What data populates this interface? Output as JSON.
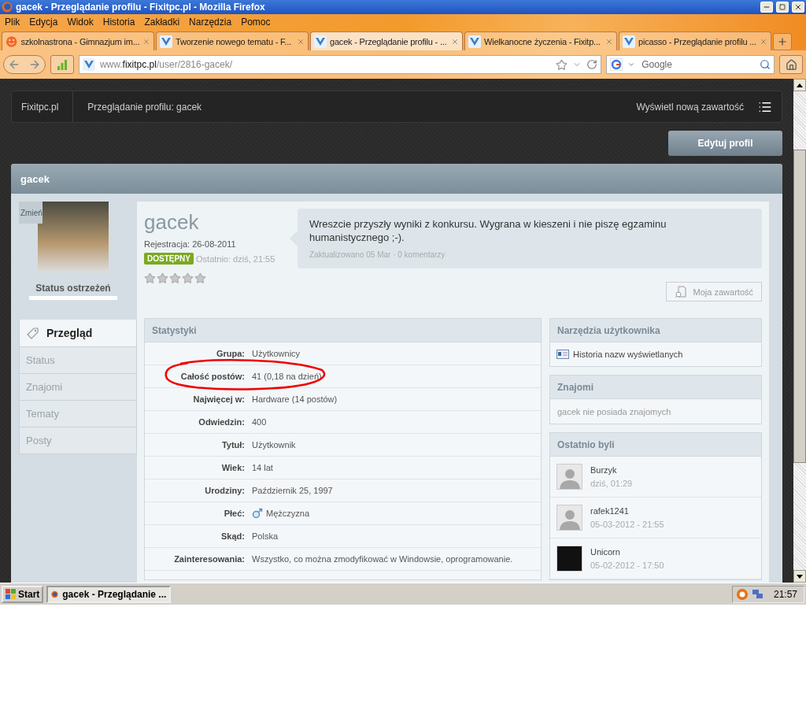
{
  "window": {
    "title": "gacek - Przeglądanie profilu - Fixitpc.pl - Mozilla Firefox"
  },
  "menu": [
    "Plik",
    "Edycja",
    "Widok",
    "Historia",
    "Zakładki",
    "Narzędzia",
    "Pomoc"
  ],
  "tabs": [
    {
      "label": "szkolnastrona - Gimnazjum im...",
      "selected": false,
      "kind": "smiley"
    },
    {
      "label": "Tworzenie nowego tematu - F...",
      "selected": false,
      "kind": "site"
    },
    {
      "label": "gacek - Przeglądanie profilu - ...",
      "selected": true,
      "kind": "site"
    },
    {
      "label": "Wielkanocne życzenia - Fixitp...",
      "selected": false,
      "kind": "site"
    },
    {
      "label": "picasso - Przeglądanie profilu ...",
      "selected": false,
      "kind": "site"
    }
  ],
  "address": {
    "prefix": "www.",
    "domain": "fixitpc.pl",
    "path": "/user/2816-gacek/"
  },
  "search": {
    "placeholder": "Google"
  },
  "breadcrumb": [
    "Fixitpc.pl",
    "Przeglądanie profilu: gacek"
  ],
  "new_content_link": "Wyświetl nową zawartość",
  "edit_button": "Edytuj profil",
  "profile": {
    "header": "gacek",
    "change_photo": "Zmień",
    "warn_label": "Status ostrzeżeń",
    "name": "gacek",
    "registered": "Rejestracja: 26-08-2011",
    "online_badge": "DOSTĘPNY",
    "last_seen": "Ostatnio: dziś, 21:55",
    "stars": 0,
    "status_update": {
      "text": "Wreszcie przyszły wyniki z konkursu. Wygrana w kieszeni i nie piszę egzaminu humanistycznego ;-).",
      "meta": "Zaktualizowano 05 Mar · 0 komentarzy"
    },
    "my_content_button": "Moja zawartość"
  },
  "side_tabs": [
    {
      "label": "Przegląd",
      "selected": true
    },
    {
      "label": "Status",
      "selected": false
    },
    {
      "label": "Znajomi",
      "selected": false
    },
    {
      "label": "Tematy",
      "selected": false
    },
    {
      "label": "Posty",
      "selected": false
    }
  ],
  "stats": {
    "title": "Statystyki",
    "rows": [
      {
        "label": "Grupa:",
        "value": "Użytkownicy",
        "kind": "text",
        "highlighted": false
      },
      {
        "label": "Całość postów:",
        "value": "41 (0,18 na dzień)",
        "kind": "text",
        "highlighted": true
      },
      {
        "label": "Najwięcej w:",
        "value": "Hardware (14 postów)",
        "kind": "text",
        "highlighted": false
      },
      {
        "label": "Odwiedzin:",
        "value": "400",
        "kind": "text",
        "highlighted": false
      },
      {
        "label": "Tytuł:",
        "value": "Użytkownik",
        "kind": "text",
        "highlighted": false
      },
      {
        "label": "Wiek:",
        "value": "14 lat",
        "kind": "text",
        "highlighted": false
      },
      {
        "label": "Urodziny:",
        "value": "Październik 25, 1997",
        "kind": "text",
        "highlighted": false
      },
      {
        "label": "Płeć:",
        "value": "Mężczyzna",
        "kind": "gender",
        "highlighted": false
      },
      {
        "label": "Skąd:",
        "value": "Polska",
        "kind": "text",
        "highlighted": false
      },
      {
        "label": "Zainteresowania:",
        "value": "Wszystko, co można zmodyfikować w Windowsie, oprogramowanie.",
        "kind": "text",
        "highlighted": false
      }
    ]
  },
  "user_tools": {
    "title": "Narzędzia użytkownika",
    "items": [
      "Historia nazw wyświetlanych"
    ]
  },
  "friends": {
    "title": "Znajomi",
    "empty_text": "gacek nie posiada znajomych"
  },
  "recent_visitors": {
    "title": "Ostatnio byli",
    "items": [
      {
        "name": "Burzyk",
        "time": "dziś, 01:29",
        "kind": "default"
      },
      {
        "name": "rafek1241",
        "time": "05-03-2012 - 21:55",
        "kind": "default"
      },
      {
        "name": "Unicorn",
        "time": "05-02-2012 - 17:50",
        "kind": "photo"
      }
    ]
  },
  "taskbar": {
    "start": "Start",
    "tasks": [
      {
        "label": "gacek - Przeglądanie ...",
        "selected": true
      }
    ],
    "clock": "21:57"
  }
}
